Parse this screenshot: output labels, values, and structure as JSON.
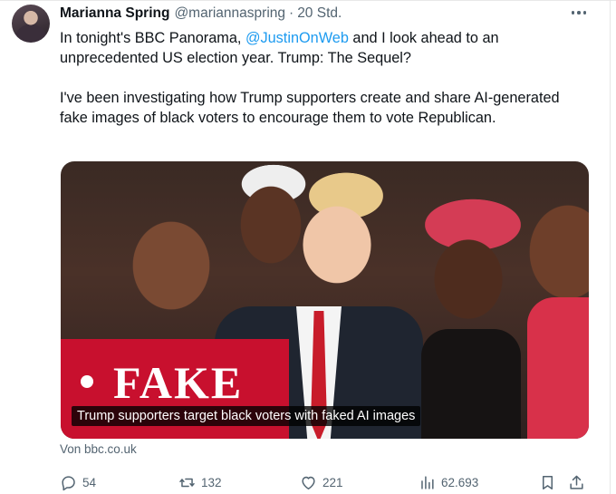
{
  "tweet": {
    "author_name": "Marianna Spring",
    "author_handle": "@mariannaspring",
    "separator": "·",
    "time": "20 Std.",
    "text_line1_pre": "In tonight's BBC Panorama, ",
    "text_mention": "@JustinOnWeb",
    "text_line1_post": " and I look ahead to an unprecedented US election year. Trump: The Sequel?",
    "text_paragraph2": "I've been investigating how Trump supporters create and share AI-generated fake images of black voters to encourage them to vote Republican."
  },
  "media": {
    "fake_label": "FAKE",
    "caption": "Trump supporters target black voters with faked AI images",
    "source": "Von bbc.co.uk"
  },
  "actions": {
    "replies": "54",
    "reposts": "132",
    "likes": "221",
    "views": "62.693"
  },
  "icons": [
    "more-icon",
    "reply-icon",
    "repost-icon",
    "like-icon",
    "views-icon",
    "bookmark-icon",
    "share-icon"
  ],
  "colors": {
    "link": "#1d9bf0",
    "muted": "#536471",
    "fake_red": "#c8102e"
  }
}
